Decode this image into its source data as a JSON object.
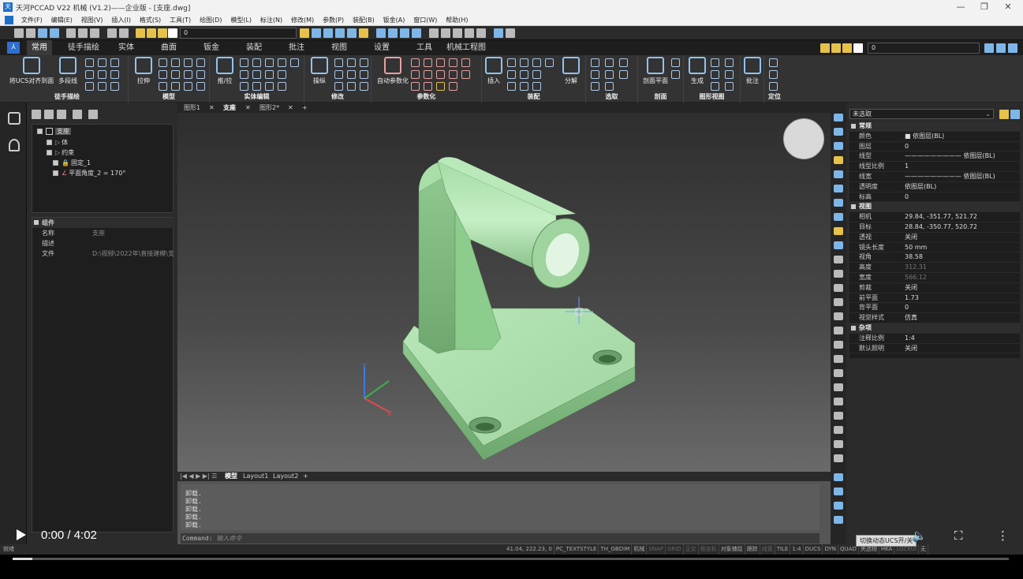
{
  "window": {
    "title": "天河PCCAD V22 机械 (V1.2)——企业版 - [支座.dwg]",
    "minimize": "—",
    "restore": "❐",
    "close": "✕"
  },
  "menu": [
    "文件(F)",
    "编辑(E)",
    "视图(V)",
    "插入(I)",
    "格式(S)",
    "工具(T)",
    "绘图(D)",
    "模型(L)",
    "标注(N)",
    "修改(M)",
    "参数(P)",
    "装配(B)",
    "钣金(A)",
    "窗口(W)",
    "帮助(H)"
  ],
  "quickbar": {
    "layer_value": "0",
    "layer_value_right": "0"
  },
  "ribbon_tabs": [
    "常用",
    "徒手描绘",
    "实体",
    "曲面",
    "钣金",
    "装配",
    "批注",
    "视图",
    "设置",
    "工具",
    "机械工程图"
  ],
  "ribbon_groups": {
    "freehand": {
      "label": "徒手描绘",
      "btn1": "将UCS对齐到面",
      "btn2": "多段线"
    },
    "model": {
      "label": "模型",
      "btn": "拉伸"
    },
    "solid_edit": {
      "label": "实体编辑",
      "btn": "推/拉"
    },
    "modify": {
      "label": "修改",
      "btn": "操纵"
    },
    "param": {
      "label": "参数化",
      "btn": "自动参数化"
    },
    "assembly": {
      "label": "装配",
      "btn1": "插入",
      "btn2": "分解"
    },
    "select": {
      "label": "选取"
    },
    "section": {
      "label": "剖面",
      "btn": "剖面平面"
    },
    "drawing_view": {
      "label": "图形视图",
      "btn": "生成"
    },
    "annotate": {
      "label": "",
      "btn": "批注"
    },
    "locate": {
      "label": "定位"
    }
  },
  "tree": {
    "root": "支座",
    "body": "体",
    "constraints": "约束",
    "fixed": "固定_1",
    "angle": "平面角度_2 = 170°"
  },
  "component": {
    "header": "组件",
    "rows": [
      {
        "k": "名称",
        "v": "支座"
      },
      {
        "k": "描述",
        "v": ""
      },
      {
        "k": "文件",
        "v": "D:\\视频\\2022年\\直接建模\\支"
      }
    ]
  },
  "doc_tabs": {
    "t1": "图形1",
    "t2": "支座",
    "t3": "图形2*",
    "close": "✕",
    "add": "+"
  },
  "layout_tabs": {
    "model": "模型",
    "l1": "Layout1",
    "l2": "Layout2",
    "add": "+"
  },
  "command": {
    "history": [
      "卸载.",
      "卸载.",
      "卸载.",
      "卸载.",
      "卸载."
    ],
    "prompt_label": "Command:",
    "prompt_placeholder": "输入命令"
  },
  "properties": {
    "selection": "未选取",
    "rows": [
      {
        "type": "hd",
        "k": "常规"
      },
      {
        "k": "颜色",
        "v": "■ 依图层(BL)"
      },
      {
        "k": "图层",
        "v": "0"
      },
      {
        "k": "线型",
        "v": "————————— 依图层(BL)"
      },
      {
        "k": "线型比例",
        "v": "1"
      },
      {
        "k": "线宽",
        "v": "————————— 依图层(BL)"
      },
      {
        "k": "透明度",
        "v": "依图层(BL)"
      },
      {
        "k": "标高",
        "v": "0"
      },
      {
        "type": "hd",
        "k": "视图"
      },
      {
        "k": "相机",
        "v": "29.84, -351.77, 521.72"
      },
      {
        "k": "目标",
        "v": "28.84, -350.77, 520.72"
      },
      {
        "k": "透视",
        "v": "关闭"
      },
      {
        "k": "镜头长度",
        "v": "50 mm"
      },
      {
        "k": "视角",
        "v": "38.58"
      },
      {
        "k": "高度",
        "v": "312.31",
        "dim": true
      },
      {
        "k": "宽度",
        "v": "566.12",
        "dim": true
      },
      {
        "k": "剪裁",
        "v": "关闭"
      },
      {
        "k": "前平面",
        "v": "1.73"
      },
      {
        "k": "背平面",
        "v": "0"
      },
      {
        "k": "视觉样式",
        "v": "仿真"
      },
      {
        "type": "hd",
        "k": "杂项"
      },
      {
        "k": "注释比例",
        "v": "1:4"
      },
      {
        "k": "默认照明",
        "v": "关闭"
      }
    ]
  },
  "status": {
    "left": "就绪",
    "coords": "41.04, 222.23, 0",
    "switches": [
      "PC_TEXTSTYLE",
      "TH_GBDIM",
      "机械",
      "SNAP",
      "GRID",
      "正交",
      "极坐标",
      "对象捕捉",
      "跟踪",
      "线宽",
      "TILE",
      "1:4",
      "DUCS",
      "DYN",
      "QUAD",
      "夹选物",
      "HKA",
      "LOCKUI",
      "无"
    ]
  },
  "video": {
    "time": "0:00 / 4:02",
    "tooltip": "切换动态UCS开/关",
    "progress_fraction": 0.02
  },
  "viewport": {
    "axis_x": "X",
    "axis_y": "Y"
  }
}
